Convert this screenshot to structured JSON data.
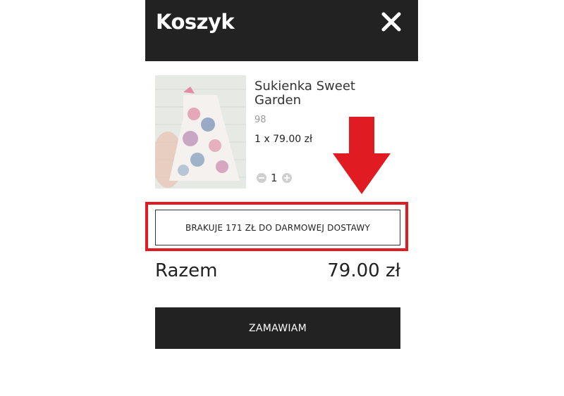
{
  "cart": {
    "title": "Koszyk",
    "close_icon": "close-icon"
  },
  "item": {
    "name": "Sukienka Sweet Garden",
    "variant": "98",
    "price_line": "1 x 79.00 zł",
    "quantity": "1"
  },
  "shipping_notice": "BRAKUJE 171 ZŁ DO DARMOWEJ DOSTAWY",
  "total": {
    "label": "Razem",
    "value": "79.00 zł"
  },
  "checkout": {
    "label": "ZAMAWIAM"
  },
  "colors": {
    "header_bg": "#222222",
    "accent_red": "#e01b22"
  }
}
